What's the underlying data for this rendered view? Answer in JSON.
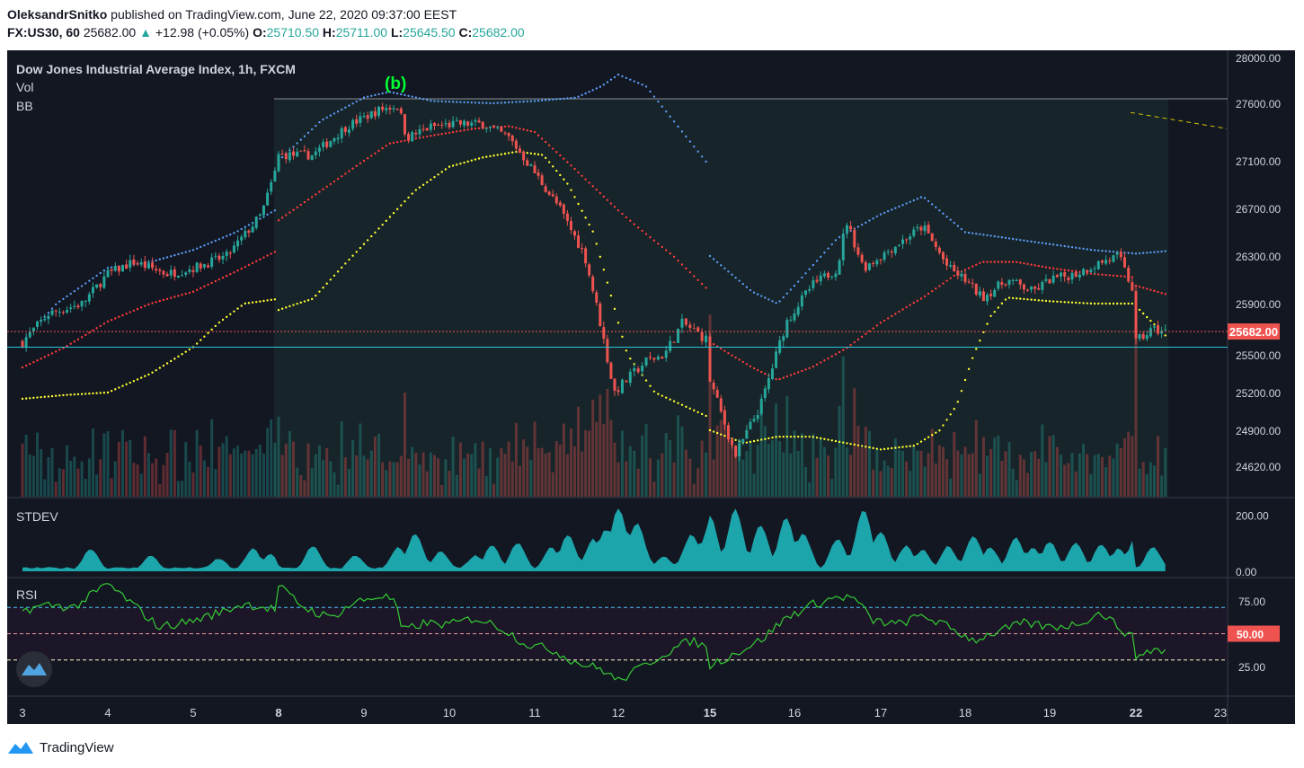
{
  "header": {
    "author": "OleksandrSnitko",
    "published": "published on TradingView.com, June 22, 2020 09:37:00 EEST",
    "symbol": "FX:US30, 60",
    "last": "25682.00",
    "change": "+12.98 (+0.05%)",
    "o_label": "O:",
    "o_value": "25710.50",
    "h_label": "H:",
    "h_value": "25711.00",
    "l_label": "L:",
    "l_value": "25645.50",
    "c_label": "C:",
    "c_value": "25682.00"
  },
  "footer": {
    "brand": "TradingView"
  },
  "colors": {
    "background": "#131722",
    "up": "#26a69a",
    "down": "#ef5350",
    "bb_upper": "#5b9cf6",
    "bb_basis": "#ff3b3b",
    "bb_lower": "#ffff33",
    "stdev_fill": "#1fb5bb",
    "rsi_line": "#33cc33",
    "wave_label": "#00ff33",
    "price_tag": "#ef5350"
  },
  "chart_data": [
    {
      "type": "candlestick",
      "title": "Dow Jones Industrial Average Index, 1h, FXCM",
      "legend": [
        "Vol",
        "BB"
      ],
      "ylim": [
        24500,
        28050
      ],
      "y_ticks": [
        "28000.00",
        "27600.00",
        "27100.00",
        "26700.00",
        "26300.00",
        "25900.00",
        "25500.00",
        "25200.00",
        "24900.00",
        "24620.00"
      ],
      "last_price_label": "25682.00",
      "last_price": 25682,
      "horizontal_level": 25560,
      "annotation": {
        "text": "(b)",
        "x": 9.37,
        "y": 27680
      },
      "x_ticks": [
        "3",
        "4",
        "5",
        "8",
        "9",
        "10",
        "11",
        "12",
        "15",
        "16",
        "17",
        "18",
        "19",
        "22",
        "23"
      ],
      "x_tick_positions": [
        3,
        4,
        5,
        8,
        9,
        10,
        11,
        12,
        15,
        16,
        17,
        18,
        19,
        22,
        23
      ],
      "x_bold_ticks": [
        "8",
        "15",
        "22"
      ],
      "close_anchors": [
        [
          3.0,
          25600
        ],
        [
          3.3,
          25820
        ],
        [
          3.7,
          25900
        ],
        [
          4.0,
          26150
        ],
        [
          4.3,
          26250
        ],
        [
          4.7,
          26150
        ],
        [
          5.0,
          26200
        ],
        [
          5.4,
          26300
        ],
        [
          5.8,
          26650
        ],
        [
          6.0,
          27100
        ],
        [
          8.0,
          27150
        ],
        [
          8.4,
          27150
        ],
        [
          8.8,
          27400
        ],
        [
          9.2,
          27550
        ],
        [
          9.4,
          27580
        ],
        [
          9.5,
          27300
        ],
        [
          9.8,
          27400
        ],
        [
          10.1,
          27420
        ],
        [
          10.4,
          27420
        ],
        [
          10.7,
          27300
        ],
        [
          11.0,
          27000
        ],
        [
          11.3,
          26700
        ],
        [
          11.6,
          26300
        ],
        [
          11.8,
          25700
        ],
        [
          11.95,
          25200
        ],
        [
          12.3,
          25450
        ],
        [
          12.5,
          25500
        ],
        [
          12.7,
          25750
        ],
        [
          13.0,
          25600
        ],
        [
          13.2,
          25300
        ],
        [
          15.0,
          25300
        ],
        [
          15.3,
          24700
        ],
        [
          15.6,
          25100
        ],
        [
          15.9,
          25750
        ],
        [
          16.2,
          26050
        ],
        [
          16.5,
          26200
        ],
        [
          16.6,
          26600
        ],
        [
          16.8,
          26200
        ],
        [
          17.2,
          26400
        ],
        [
          17.5,
          26550
        ],
        [
          17.8,
          26200
        ],
        [
          18.0,
          26100
        ],
        [
          18.2,
          25950
        ],
        [
          18.5,
          26100
        ],
        [
          18.8,
          26000
        ],
        [
          19.0,
          26100
        ],
        [
          19.3,
          26150
        ],
        [
          19.6,
          26250
        ],
        [
          19.8,
          26300
        ],
        [
          20.0,
          25950
        ],
        [
          22.0,
          25600
        ],
        [
          22.2,
          25700
        ],
        [
          22.35,
          25682
        ]
      ],
      "upper_anchors": [
        [
          3.0,
          25600
        ],
        [
          3.4,
          25900
        ],
        [
          4.0,
          26200
        ],
        [
          4.5,
          26250
        ],
        [
          5.0,
          26350
        ],
        [
          5.5,
          26500
        ],
        [
          6.0,
          26700
        ],
        [
          8.0,
          27100
        ],
        [
          8.5,
          27450
        ],
        [
          9.0,
          27650
        ],
        [
          9.3,
          27700
        ],
        [
          9.8,
          27620
        ],
        [
          10.5,
          27600
        ],
        [
          11.0,
          27620
        ],
        [
          11.5,
          27650
        ],
        [
          11.8,
          27750
        ],
        [
          12.0,
          27850
        ],
        [
          12.3,
          27750
        ],
        [
          12.7,
          27350
        ],
        [
          13.2,
          26850
        ],
        [
          15.0,
          26300
        ],
        [
          15.5,
          26000
        ],
        [
          15.8,
          25900
        ],
        [
          16.0,
          26050
        ],
        [
          16.5,
          26450
        ],
        [
          17.0,
          26650
        ],
        [
          17.5,
          26800
        ],
        [
          18.0,
          26500
        ],
        [
          18.5,
          26450
        ],
        [
          19.0,
          26400
        ],
        [
          19.5,
          26350
        ],
        [
          20.0,
          26320
        ],
        [
          22.0,
          26320
        ],
        [
          22.35,
          26340
        ]
      ],
      "basis_anchors": [
        [
          3.0,
          25400
        ],
        [
          3.5,
          25560
        ],
        [
          4.0,
          25760
        ],
        [
          4.5,
          25900
        ],
        [
          5.0,
          26000
        ],
        [
          5.5,
          26170
        ],
        [
          6.0,
          26350
        ],
        [
          8.0,
          26600
        ],
        [
          8.5,
          26850
        ],
        [
          9.0,
          27100
        ],
        [
          9.3,
          27250
        ],
        [
          9.8,
          27320
        ],
        [
          10.3,
          27380
        ],
        [
          10.7,
          27400
        ],
        [
          11.0,
          27350
        ],
        [
          11.3,
          27150
        ],
        [
          11.6,
          26950
        ],
        [
          11.9,
          26750
        ],
        [
          12.2,
          26550
        ],
        [
          12.6,
          26300
        ],
        [
          13.0,
          26000
        ],
        [
          13.3,
          25850
        ],
        [
          15.0,
          25600
        ],
        [
          15.5,
          25400
        ],
        [
          15.8,
          25300
        ],
        [
          16.2,
          25400
        ],
        [
          16.6,
          25550
        ],
        [
          17.0,
          25750
        ],
        [
          17.5,
          25950
        ],
        [
          17.9,
          26150
        ],
        [
          18.2,
          26250
        ],
        [
          18.6,
          26250
        ],
        [
          19.0,
          26200
        ],
        [
          19.5,
          26150
        ],
        [
          20.0,
          26120
        ],
        [
          22.0,
          26050
        ],
        [
          22.35,
          25980
        ]
      ],
      "lower_anchors": [
        [
          3.0,
          25150
        ],
        [
          3.5,
          25180
        ],
        [
          4.0,
          25200
        ],
        [
          4.5,
          25350
        ],
        [
          5.0,
          25560
        ],
        [
          5.3,
          25750
        ],
        [
          5.6,
          25900
        ],
        [
          6.0,
          25940
        ],
        [
          8.0,
          25850
        ],
        [
          8.4,
          25940
        ],
        [
          8.8,
          26250
        ],
        [
          9.2,
          26550
        ],
        [
          9.6,
          26850
        ],
        [
          10.0,
          27050
        ],
        [
          10.4,
          27130
        ],
        [
          10.8,
          27180
        ],
        [
          11.1,
          27150
        ],
        [
          11.4,
          26900
        ],
        [
          11.7,
          26500
        ],
        [
          11.9,
          26000
        ],
        [
          12.1,
          25500
        ],
        [
          12.4,
          25200
        ],
        [
          12.7,
          25100
        ],
        [
          13.0,
          25000
        ],
        [
          13.3,
          24980
        ],
        [
          15.0,
          24900
        ],
        [
          15.4,
          24800
        ],
        [
          15.8,
          24850
        ],
        [
          16.2,
          24850
        ],
        [
          16.6,
          24800
        ],
        [
          17.0,
          24750
        ],
        [
          17.4,
          24780
        ],
        [
          17.7,
          24900
        ],
        [
          17.9,
          25100
        ],
        [
          18.0,
          25300
        ],
        [
          18.1,
          25500
        ],
        [
          18.3,
          25800
        ],
        [
          18.5,
          25950
        ],
        [
          19.0,
          25920
        ],
        [
          19.5,
          25900
        ],
        [
          20.0,
          25900
        ],
        [
          22.0,
          25880
        ],
        [
          22.35,
          25650
        ]
      ],
      "trend_line": [
        [
          21.8,
          27520
        ],
        [
          22.9,
          27380
        ]
      ]
    },
    {
      "type": "area",
      "title": "STDEV",
      "ylim": [
        0,
        230
      ],
      "y_ticks": [
        "200.00",
        "0.00"
      ],
      "y_tick_values": [
        200,
        0
      ],
      "peaks": [
        [
          3.8,
          80
        ],
        [
          4.5,
          55
        ],
        [
          5.3,
          45
        ],
        [
          5.7,
          80
        ],
        [
          5.9,
          60
        ],
        [
          7.8,
          225
        ],
        [
          8.4,
          90
        ],
        [
          8.9,
          55
        ],
        [
          9.4,
          85
        ],
        [
          9.6,
          135
        ],
        [
          9.9,
          70
        ],
        [
          10.3,
          55
        ],
        [
          10.5,
          90
        ],
        [
          10.8,
          100
        ],
        [
          11.2,
          85
        ],
        [
          11.4,
          130
        ],
        [
          11.7,
          115
        ],
        [
          11.85,
          150
        ],
        [
          12.0,
          225
        ],
        [
          12.2,
          170
        ],
        [
          12.5,
          50
        ],
        [
          12.8,
          130
        ],
        [
          13.0,
          160
        ],
        [
          13.2,
          220
        ],
        [
          15.0,
          195
        ],
        [
          15.3,
          220
        ],
        [
          15.6,
          165
        ],
        [
          15.9,
          190
        ],
        [
          16.1,
          135
        ],
        [
          16.5,
          115
        ],
        [
          16.8,
          220
        ],
        [
          17.0,
          140
        ],
        [
          17.3,
          90
        ],
        [
          17.5,
          75
        ],
        [
          17.8,
          90
        ],
        [
          18.1,
          125
        ],
        [
          18.3,
          85
        ],
        [
          18.6,
          120
        ],
        [
          18.8,
          85
        ],
        [
          19.0,
          105
        ],
        [
          19.3,
          100
        ],
        [
          19.6,
          95
        ],
        [
          19.8,
          80
        ],
        [
          20.0,
          120
        ],
        [
          21.7,
          150
        ],
        [
          22.2,
          85
        ]
      ]
    },
    {
      "type": "line",
      "title": "RSI",
      "ylim": [
        10,
        90
      ],
      "y_ticks": [
        "75.00",
        "50.00",
        "25.00"
      ],
      "y_tick_values": [
        75,
        50,
        25
      ],
      "levels": [
        70,
        50,
        30
      ],
      "anchors": [
        [
          3.0,
          68
        ],
        [
          3.3,
          72
        ],
        [
          3.6,
          70
        ],
        [
          4.0,
          88
        ],
        [
          4.3,
          72
        ],
        [
          4.6,
          55
        ],
        [
          5.0,
          60
        ],
        [
          5.3,
          66
        ],
        [
          5.6,
          73
        ],
        [
          6.0,
          68
        ],
        [
          8.0,
          86
        ],
        [
          8.3,
          70
        ],
        [
          8.6,
          62
        ],
        [
          8.9,
          74
        ],
        [
          9.2,
          79
        ],
        [
          9.35,
          76
        ],
        [
          9.45,
          52
        ],
        [
          9.7,
          58
        ],
        [
          10.0,
          57
        ],
        [
          10.3,
          62
        ],
        [
          10.6,
          55
        ],
        [
          10.9,
          42
        ],
        [
          11.2,
          38
        ],
        [
          11.5,
          28
        ],
        [
          11.8,
          23
        ],
        [
          12.0,
          14
        ],
        [
          12.2,
          22
        ],
        [
          12.5,
          35
        ],
        [
          12.8,
          45
        ],
        [
          13.0,
          38
        ],
        [
          13.3,
          35
        ],
        [
          15.0,
          26
        ],
        [
          15.3,
          35
        ],
        [
          15.6,
          45
        ],
        [
          15.9,
          62
        ],
        [
          16.2,
          72
        ],
        [
          16.5,
          78
        ],
        [
          16.7,
          77
        ],
        [
          16.9,
          60
        ],
        [
          17.2,
          57
        ],
        [
          17.5,
          64
        ],
        [
          17.8,
          55
        ],
        [
          18.1,
          45
        ],
        [
          18.4,
          52
        ],
        [
          18.7,
          58
        ],
        [
          19.0,
          55
        ],
        [
          19.3,
          57
        ],
        [
          19.6,
          66
        ],
        [
          19.8,
          55
        ],
        [
          20.0,
          45
        ],
        [
          21.8,
          30
        ],
        [
          22.0,
          33
        ],
        [
          22.2,
          38
        ],
        [
          22.35,
          37
        ]
      ]
    }
  ]
}
